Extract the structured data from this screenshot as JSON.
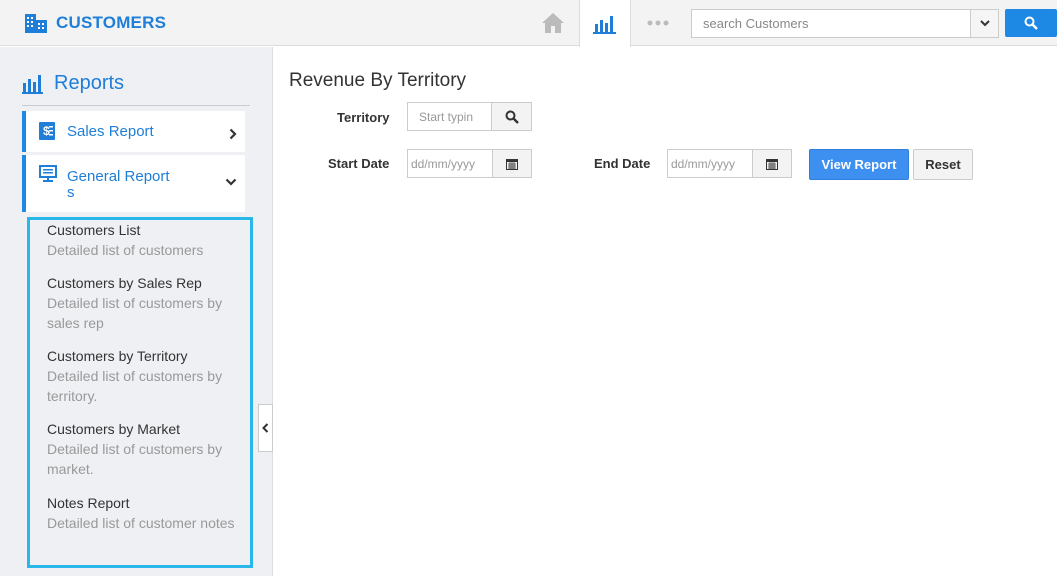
{
  "app": {
    "title": "CUSTOMERS",
    "icon": "building-icon",
    "accent_color": "#1e7ed8"
  },
  "topbar": {
    "nav": [
      {
        "name": "home",
        "icon": "home-icon",
        "active": false
      },
      {
        "name": "reports",
        "icon": "bar-chart-icon",
        "active": true
      },
      {
        "name": "more",
        "icon": "more-dots-icon",
        "active": false
      }
    ],
    "search": {
      "placeholder": "search Customers",
      "value": "",
      "dropdown_icon": "chevron-down-icon",
      "button_icon": "search-icon"
    }
  },
  "sidebar": {
    "heading": "Reports",
    "heading_icon": "bar-chart-icon",
    "items": [
      {
        "label": "Sales Report",
        "icon": "dollar-doc-icon",
        "chevron": "chevron-right-icon",
        "expanded": false
      },
      {
        "label_line1": "General Report",
        "label_line2": "s",
        "icon": "monitor-icon",
        "chevron": "chevron-down-icon",
        "expanded": true
      }
    ],
    "submenu": [
      {
        "title": "Customers List",
        "desc_lines": [
          "Detailed list of customers"
        ]
      },
      {
        "title": "Customers by Sales Rep",
        "desc_lines": [
          "Detailed list of customers by",
          "sales rep"
        ]
      },
      {
        "title": "Customers by Territory",
        "desc_lines": [
          "Detailed list of customers by",
          "territory."
        ]
      },
      {
        "title": "Customers by Market",
        "desc_lines": [
          "Detailed list of customers by",
          "market."
        ]
      },
      {
        "title": "Notes Report",
        "desc_lines": [
          "Detailed list of customer notes"
        ]
      }
    ],
    "highlight_color": "#29b6e8"
  },
  "main": {
    "title": "Revenue By Territory",
    "territory": {
      "label": "Territory",
      "placeholder": "Start typin",
      "value": "",
      "icon": "search-icon"
    },
    "start_date": {
      "label": "Start Date",
      "placeholder": "dd/mm/yyyy",
      "value": "",
      "icon": "calendar-icon"
    },
    "end_date": {
      "label": "End Date",
      "placeholder": "dd/mm/yyyy",
      "value": "",
      "icon": "calendar-icon"
    },
    "view_button": "View Report",
    "reset_button": "Reset"
  }
}
